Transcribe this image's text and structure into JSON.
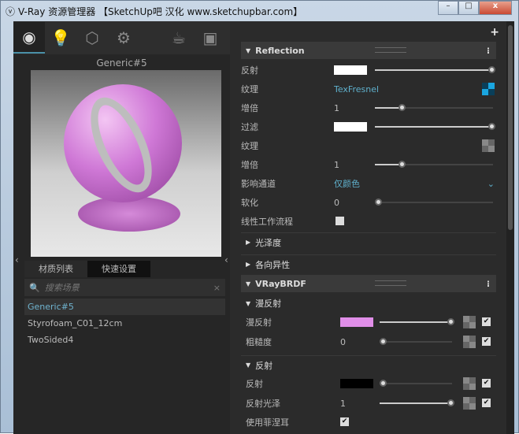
{
  "window": {
    "title": "V-Ray 资源管理器 【SketchUp吧 汉化 www.sketchupbar.com】",
    "minimize": "–",
    "maximize": "□",
    "close": "x"
  },
  "left": {
    "material_name": "Generic#5",
    "tabs": [
      "材质列表",
      "快速设置"
    ],
    "search_placeholder": "搜索场景",
    "search_clear": "×",
    "materials": [
      "Generic#5",
      "Styrofoam_C01_12cm",
      "TwoSided4"
    ]
  },
  "right": {
    "add": "+",
    "reflection": {
      "title": "Reflection",
      "more": "⁝",
      "rows": [
        {
          "label": "反射",
          "color": "#ffffff",
          "value": 1.0
        },
        {
          "label": "纹理",
          "texture": "TexFresnel"
        },
        {
          "label": "增倍",
          "value": "1",
          "slider": 0.22
        },
        {
          "label": "过滤",
          "color": "#ffffff",
          "value": 1.0
        },
        {
          "label": "纹理"
        },
        {
          "label": "增倍",
          "value": "1",
          "slider": 0.22
        },
        {
          "label": "影响通道",
          "value": "仅颜色"
        },
        {
          "label": "软化",
          "value": "0",
          "slider": 0.0
        },
        {
          "label": "线性工作流程",
          "checked": false
        }
      ]
    },
    "gloss": "光泽度",
    "aniso": "各向异性",
    "brdf": {
      "title": "VRayBRDF",
      "more": "⁝",
      "diffuse_title": "漫反射",
      "diffuse": {
        "label": "漫反射",
        "color": "#e08ee8",
        "slider": 1.0
      },
      "roughness": {
        "label": "粗糙度",
        "value": "0",
        "slider": 0.0
      },
      "refl_title": "反射",
      "refl": {
        "label": "反射",
        "color": "#000000",
        "slider": 0.0
      },
      "refl_gloss": {
        "label": "反射光泽",
        "value": "1",
        "slider": 1.0
      },
      "fresnel": {
        "label": "使用菲涅耳",
        "checked": true
      }
    }
  }
}
